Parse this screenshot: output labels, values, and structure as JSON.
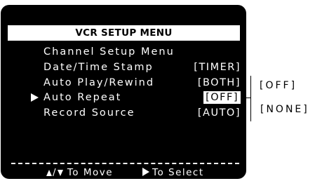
{
  "menu": {
    "title": "VCR SETUP MENU",
    "items": [
      {
        "label": "Channel Setup Menu",
        "value": ""
      },
      {
        "label": "Date/Time Stamp",
        "value": "[TIMER]"
      },
      {
        "label": "Auto Play/Rewind",
        "value": "[BOTH]"
      },
      {
        "label": "Auto Repeat",
        "value": "[OFF]",
        "selected": true
      },
      {
        "label": "Record Source",
        "value": "[AUTO]"
      }
    ]
  },
  "footer": {
    "move_label": "To Move",
    "select_label": "To Select"
  },
  "options": {
    "first": "[OFF]",
    "second": "[NONE]"
  },
  "colors": {
    "screen_background": "#000000",
    "text": "#ffffff",
    "title_bar": "#ffffff",
    "highlight": "#ffffff"
  },
  "icons": {
    "cursor": "right-triangle",
    "move": "up-down-triangles",
    "select": "right-triangle"
  }
}
